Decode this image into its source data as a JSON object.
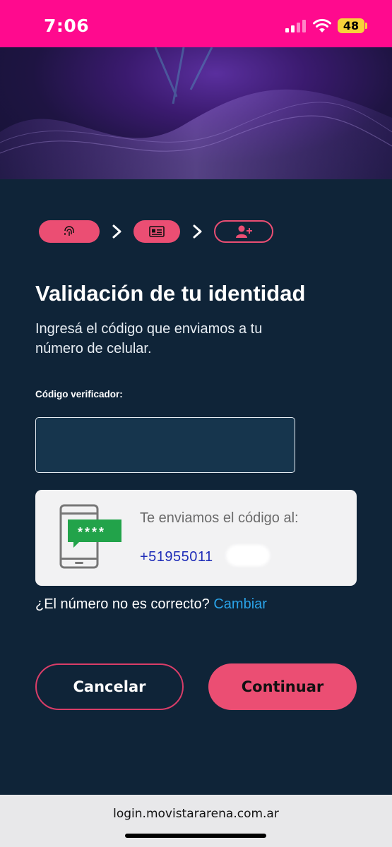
{
  "status_bar": {
    "time": "7:06",
    "battery": "48"
  },
  "steps": [
    {
      "icon": "fingerprint-icon",
      "state": "filled"
    },
    {
      "icon": "id-card-icon",
      "state": "filled"
    },
    {
      "icon": "user-add-icon",
      "state": "outline"
    }
  ],
  "main": {
    "title": "Validación de tu identidad",
    "subtitle": "Ingresá el código que enviamos a tu número de celular.",
    "code_label": "Código verificador:",
    "code_value": "",
    "info_text": "Te enviamos el código al:",
    "phone_number": "+51955011",
    "phone_code_bubble": "****",
    "change_prompt": "¿El número no es correcto?",
    "change_link": "Cambiar"
  },
  "buttons": {
    "cancel": "Cancelar",
    "continue": "Continuar"
  },
  "browser": {
    "url": "login.movistararena.com.ar"
  },
  "colors": {
    "accent": "#eb4e73",
    "background": "#0f2438",
    "status_bar": "#ff0a8e",
    "link": "#2aa3e8"
  }
}
